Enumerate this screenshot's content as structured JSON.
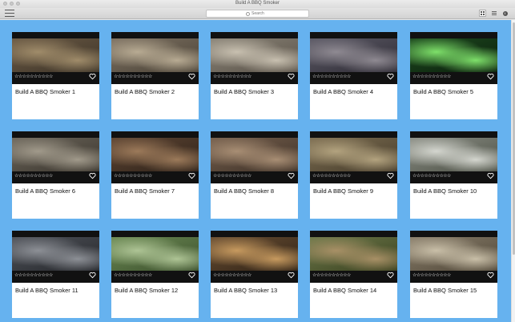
{
  "window": {
    "title": "Build A BBQ Smoker"
  },
  "toolbar": {
    "search_placeholder": "Search",
    "view_mode": "grid",
    "icons": [
      "menu-icon",
      "search-icon",
      "grid-view-icon",
      "list-view-icon",
      "info-icon"
    ]
  },
  "colors": {
    "background": "#66b2ef",
    "card": "#ffffff",
    "thumb_frame": "#111111"
  },
  "videos": [
    {
      "title": "Build A BBQ Smoker 1",
      "rating": "☆☆☆☆☆☆☆☆☆☆",
      "favorite": false,
      "palette": [
        "#6b5a45",
        "#a08c6a",
        "#3d3428"
      ]
    },
    {
      "title": "Build A BBQ Smoker 2",
      "rating": "☆☆☆☆☆☆☆☆☆☆",
      "favorite": false,
      "palette": [
        "#7e7263",
        "#b8ab93",
        "#4a4236"
      ]
    },
    {
      "title": "Build A BBQ Smoker 3",
      "rating": "☆☆☆☆☆☆☆☆☆☆",
      "favorite": false,
      "palette": [
        "#8a8478",
        "#c8c0b0",
        "#5a5248"
      ]
    },
    {
      "title": "Build A BBQ Smoker 4",
      "rating": "☆☆☆☆☆☆☆☆☆☆",
      "favorite": false,
      "palette": [
        "#5c5a66",
        "#8f8a92",
        "#2f2c35"
      ]
    },
    {
      "title": "Build A BBQ Smoker 5",
      "rating": "☆☆☆☆☆☆☆☆☆☆",
      "favorite": false,
      "palette": [
        "#1d4a1f",
        "#7ee06a",
        "#0c1f0d"
      ]
    },
    {
      "title": "Build A BBQ Smoker 6",
      "rating": "☆☆☆☆☆☆☆☆☆☆",
      "favorite": false,
      "palette": [
        "#6d675c",
        "#a19a8b",
        "#3a352d"
      ]
    },
    {
      "title": "Build A BBQ Smoker 7",
      "rating": "☆☆☆☆☆☆☆☆☆☆",
      "favorite": false,
      "palette": [
        "#5f4634",
        "#9c7a5a",
        "#2e2219"
      ]
    },
    {
      "title": "Build A BBQ Smoker 8",
      "rating": "☆☆☆☆☆☆☆☆☆☆",
      "favorite": false,
      "palette": [
        "#76604e",
        "#a88e74",
        "#3e3127"
      ]
    },
    {
      "title": "Build A BBQ Smoker 9",
      "rating": "☆☆☆☆☆☆☆☆☆☆",
      "favorite": false,
      "palette": [
        "#7d6e52",
        "#b3a37f",
        "#463c2b"
      ]
    },
    {
      "title": "Build A BBQ Smoker 10",
      "rating": "☆☆☆☆☆☆☆☆☆☆",
      "favorite": false,
      "palette": [
        "#8c8f86",
        "#d4d6cf",
        "#4c5045"
      ]
    },
    {
      "title": "Build A BBQ Smoker 11",
      "rating": "☆☆☆☆☆☆☆☆☆☆",
      "favorite": false,
      "palette": [
        "#50535a",
        "#8d9096",
        "#25272b"
      ]
    },
    {
      "title": "Build A BBQ Smoker 12",
      "rating": "☆☆☆☆☆☆☆☆☆☆",
      "favorite": false,
      "palette": [
        "#6d8b55",
        "#aec495",
        "#3b4f2c"
      ]
    },
    {
      "title": "Build A BBQ Smoker 13",
      "rating": "☆☆☆☆☆☆☆☆☆☆",
      "favorite": false,
      "palette": [
        "#6a4f33",
        "#c79a5f",
        "#2f2216"
      ]
    },
    {
      "title": "Build A BBQ Smoker 14",
      "rating": "☆☆☆☆☆☆☆☆☆☆",
      "favorite": false,
      "palette": [
        "#6e7a4b",
        "#a89066",
        "#39401f"
      ]
    },
    {
      "title": "Build A BBQ Smoker 15",
      "rating": "☆☆☆☆☆☆☆☆☆☆",
      "favorite": false,
      "palette": [
        "#8a7f6c",
        "#c9bfa8",
        "#4f4637"
      ]
    }
  ]
}
